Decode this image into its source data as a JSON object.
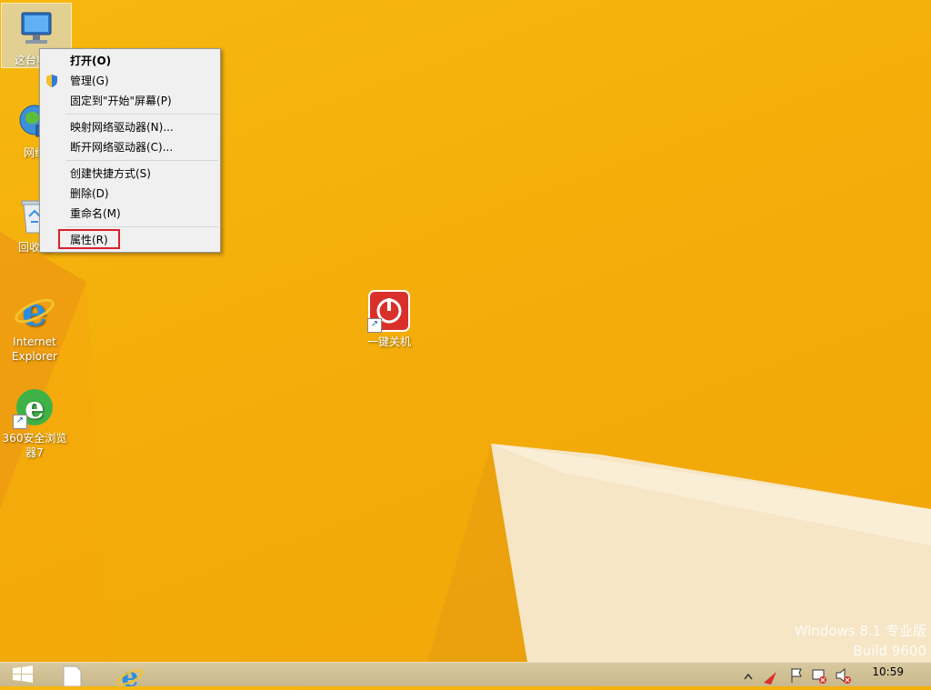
{
  "desktop": {
    "icons": [
      {
        "label": "这台电脑"
      },
      {
        "label": "网络"
      },
      {
        "label": "回收站"
      },
      {
        "label": "Internet Explorer"
      },
      {
        "label": "360安全浏览器7"
      },
      {
        "label": "一键关机"
      }
    ]
  },
  "context_menu": {
    "items": [
      {
        "label": "打开(O)"
      },
      {
        "label": "管理(G)"
      },
      {
        "label": "固定到\"开始\"屏幕(P)"
      },
      {
        "label": "映射网络驱动器(N)..."
      },
      {
        "label": "断开网络驱动器(C)..."
      },
      {
        "label": "创建快捷方式(S)"
      },
      {
        "label": "删除(D)"
      },
      {
        "label": "重命名(M)"
      },
      {
        "label": "属性(R)"
      }
    ]
  },
  "watermark": {
    "line1": "Windows 8.1 专业版",
    "line2": "Build 9600"
  },
  "taskbar": {
    "time": "10:59",
    "icons": [
      "windows-logo-icon",
      "file-explorer-icon",
      "ie-icon",
      "show-hidden-icons-icon",
      "flag-icon",
      "network-icon",
      "volume-muted-icon"
    ]
  },
  "colors": {
    "background": "#f4ad0a",
    "menu_highlight_border": "#d9202a"
  }
}
